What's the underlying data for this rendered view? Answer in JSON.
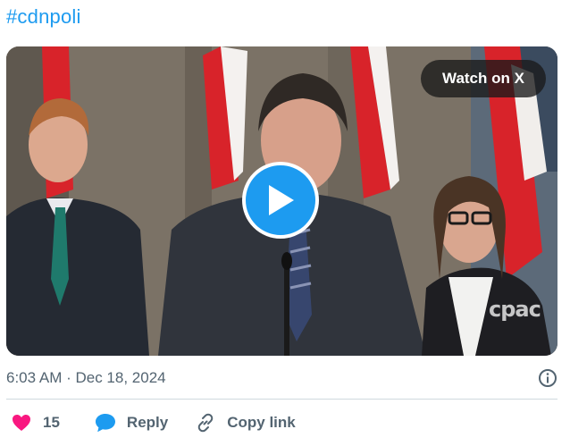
{
  "post": {
    "hashtag": "#cdnpoli",
    "timestamp": "6:03 AM · Dec 18, 2024"
  },
  "video": {
    "watch_label": "Watch on X",
    "watermark": "cpac"
  },
  "actions": {
    "like_count": "15",
    "reply_label": "Reply",
    "copy_label": "Copy link"
  },
  "colors": {
    "accent": "#1d9bf0",
    "like": "#f91880",
    "muted": "#536471"
  },
  "icons": [
    "play-icon",
    "info-icon",
    "heart-icon",
    "reply-bubble-icon",
    "link-icon"
  ]
}
